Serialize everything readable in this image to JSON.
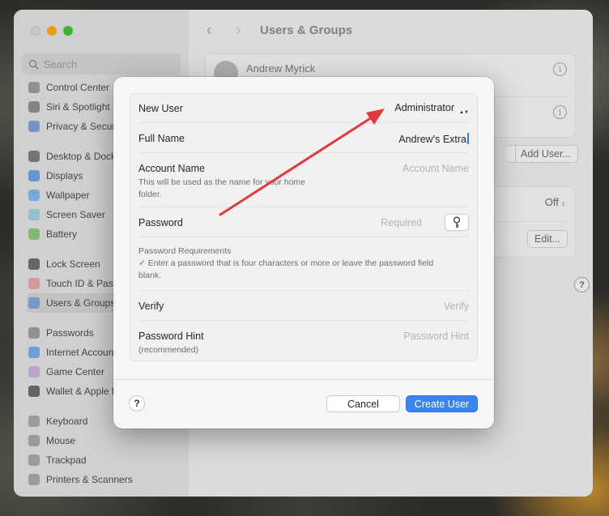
{
  "window": {
    "title": "Users & Groups"
  },
  "sidebar": {
    "search_placeholder": "Search",
    "groups": [
      [
        {
          "label": "Control Center",
          "icon": "control-center-icon",
          "color": "#9a9a9a"
        },
        {
          "label": "Siri & Spotlight",
          "icon": "siri-icon",
          "color": "#8d8d8d"
        },
        {
          "label": "Privacy & Security",
          "icon": "privacy-icon",
          "color": "#7f9fd0"
        }
      ],
      [
        {
          "label": "Desktop & Dock",
          "icon": "desktop-dock-icon",
          "color": "#7d7d7d"
        },
        {
          "label": "Displays",
          "icon": "displays-icon",
          "color": "#6e9fe0"
        },
        {
          "label": "Wallpaper",
          "icon": "wallpaper-icon",
          "color": "#7fb7e6"
        },
        {
          "label": "Screen Saver",
          "icon": "screen-saver-icon",
          "color": "#9ccfe0"
        },
        {
          "label": "Battery",
          "icon": "battery-icon",
          "color": "#8cc47a"
        }
      ],
      [
        {
          "label": "Lock Screen",
          "icon": "lock-screen-icon",
          "color": "#6e6e6e"
        },
        {
          "label": "Touch ID & Password",
          "icon": "touch-id-icon",
          "color": "#e4a3a3"
        },
        {
          "label": "Users & Groups",
          "icon": "users-groups-icon",
          "color": "#7fa3d6",
          "selected": true
        }
      ],
      [
        {
          "label": "Passwords",
          "icon": "passwords-icon",
          "color": "#9b9b9b"
        },
        {
          "label": "Internet Accounts",
          "icon": "internet-accounts-icon",
          "color": "#78a8e4"
        },
        {
          "label": "Game Center",
          "icon": "game-center-icon",
          "color": "#c9b0d8"
        },
        {
          "label": "Wallet & Apple Pay",
          "icon": "wallet-icon",
          "color": "#6a6a6a"
        }
      ],
      [
        {
          "label": "Keyboard",
          "icon": "keyboard-icon",
          "color": "#a5a5a5"
        },
        {
          "label": "Mouse",
          "icon": "mouse-icon",
          "color": "#a5a5a5"
        },
        {
          "label": "Trackpad",
          "icon": "trackpad-icon",
          "color": "#a5a5a5"
        },
        {
          "label": "Printers & Scanners",
          "icon": "printers-icon",
          "color": "#a5a5a5"
        }
      ]
    ]
  },
  "main": {
    "user_name": "Andrew Myrick",
    "add_user_label": "Add User...",
    "auto_login_value": "Off",
    "edit_label": "Edit...",
    "help_label": "?"
  },
  "dialog": {
    "new_user_label": "New User",
    "new_user_value": "Administrator",
    "full_name_label": "Full Name",
    "full_name_value": "Andrew's Extra",
    "account_name_label": "Account Name",
    "account_name_hint": "This will be used as the name for your home folder.",
    "account_name_placeholder": "Account Name",
    "password_label": "Password",
    "password_placeholder": "Required",
    "requirements_title": "Password Requirements",
    "requirements_text": "✓ Enter a password that is four characters or more or leave the password field blank.",
    "verify_label": "Verify",
    "verify_placeholder": "Verify",
    "hint_label": "Password Hint",
    "hint_sub": "(recommended)",
    "hint_placeholder": "Password Hint",
    "help_label": "?",
    "cancel_label": "Cancel",
    "create_label": "Create User"
  },
  "colors": {
    "accent": "#3a84f0",
    "annotation_arrow": "#e0393e"
  }
}
